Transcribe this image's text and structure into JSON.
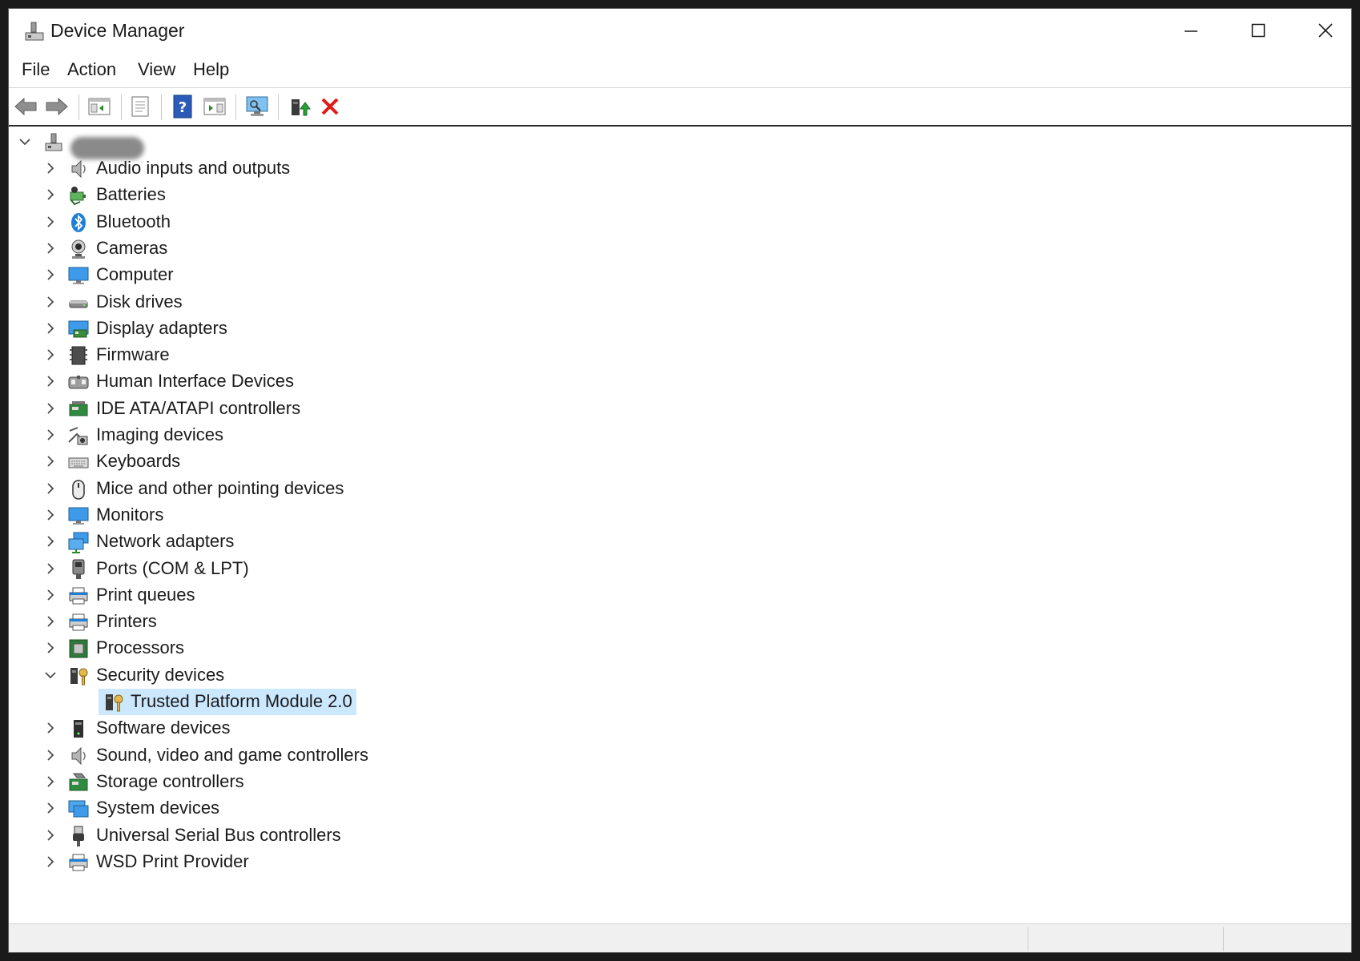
{
  "window": {
    "title": "Device Manager",
    "controls": {
      "minimize": "minimize-icon",
      "maximize": "maximize-icon",
      "close": "close-icon"
    }
  },
  "menu": {
    "items": [
      "File",
      "Action",
      "View",
      "Help"
    ]
  },
  "toolbar": {
    "buttons": [
      "back-arrow-icon",
      "forward-arrow-icon",
      "show-hide-console-tree-icon",
      "properties-icon",
      "help-icon",
      "action-pane-icon",
      "scan-hardware-changes-icon",
      "update-driver-icon",
      "uninstall-device-icon"
    ]
  },
  "tree": {
    "root": {
      "expanded": true,
      "icon": "computer-root-icon"
    },
    "categories": [
      {
        "label": "Audio inputs and outputs",
        "icon": "speaker-icon",
        "expanded": false
      },
      {
        "label": "Batteries",
        "icon": "battery-icon",
        "expanded": false
      },
      {
        "label": "Bluetooth",
        "icon": "bluetooth-icon",
        "expanded": false
      },
      {
        "label": "Cameras",
        "icon": "camera-icon",
        "expanded": false
      },
      {
        "label": "Computer",
        "icon": "computer-icon",
        "expanded": false
      },
      {
        "label": "Disk drives",
        "icon": "disk-drive-icon",
        "expanded": false
      },
      {
        "label": "Display adapters",
        "icon": "display-adapter-icon",
        "expanded": false
      },
      {
        "label": "Firmware",
        "icon": "firmware-icon",
        "expanded": false
      },
      {
        "label": "Human Interface Devices",
        "icon": "hid-icon",
        "expanded": false
      },
      {
        "label": "IDE ATA/ATAPI controllers",
        "icon": "ide-controller-icon",
        "expanded": false
      },
      {
        "label": "Imaging devices",
        "icon": "imaging-device-icon",
        "expanded": false
      },
      {
        "label": "Keyboards",
        "icon": "keyboard-icon",
        "expanded": false
      },
      {
        "label": "Mice and other pointing devices",
        "icon": "mouse-icon",
        "expanded": false
      },
      {
        "label": "Monitors",
        "icon": "monitor-icon",
        "expanded": false
      },
      {
        "label": "Network adapters",
        "icon": "network-adapter-icon",
        "expanded": false
      },
      {
        "label": "Ports (COM & LPT)",
        "icon": "port-icon",
        "expanded": false
      },
      {
        "label": "Print queues",
        "icon": "print-queue-icon",
        "expanded": false
      },
      {
        "label": "Printers",
        "icon": "printer-icon",
        "expanded": false
      },
      {
        "label": "Processors",
        "icon": "processor-icon",
        "expanded": false
      },
      {
        "label": "Security devices",
        "icon": "security-device-icon",
        "expanded": true
      },
      {
        "label": "Software devices",
        "icon": "software-device-icon",
        "expanded": false
      },
      {
        "label": "Sound, video and game controllers",
        "icon": "sound-controller-icon",
        "expanded": false
      },
      {
        "label": "Storage controllers",
        "icon": "storage-controller-icon",
        "expanded": false
      },
      {
        "label": "System devices",
        "icon": "system-device-icon",
        "expanded": false
      },
      {
        "label": "Universal Serial Bus controllers",
        "icon": "usb-icon",
        "expanded": false
      },
      {
        "label": "WSD Print Provider",
        "icon": "wsd-printer-icon",
        "expanded": false
      }
    ],
    "security_children": [
      {
        "label": "Trusted Platform Module 2.0",
        "icon": "tpm-icon",
        "selected": true
      }
    ]
  },
  "colors": {
    "selection": "#cce8ff",
    "accent_blue": "#1f7fd6",
    "delete_red": "#e01b1b"
  }
}
